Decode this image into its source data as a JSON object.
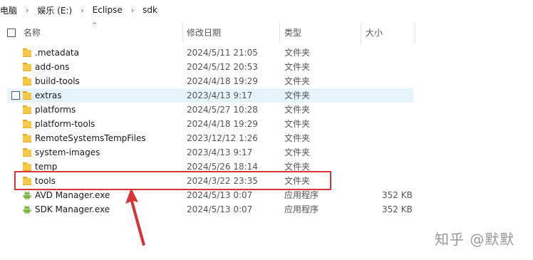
{
  "breadcrumb": {
    "items": [
      "电脑",
      "娱乐 (E:)",
      "Eclipse",
      "sdk"
    ],
    "separator": "›"
  },
  "header": {
    "name": "名称",
    "date": "修改日期",
    "type": "类型",
    "size": "大小"
  },
  "files": [
    {
      "name": ".metadata",
      "date": "2024/5/11 21:05",
      "type": "文件夹",
      "size": "",
      "icon": "folder-icon"
    },
    {
      "name": "add-ons",
      "date": "2024/5/12 20:53",
      "type": "文件夹",
      "size": "",
      "icon": "folder-icon"
    },
    {
      "name": "build-tools",
      "date": "2024/4/18 19:29",
      "type": "文件夹",
      "size": "",
      "icon": "folder-icon"
    },
    {
      "name": "extras",
      "date": "2023/4/13 9:17",
      "type": "文件夹",
      "size": "",
      "icon": "folder-icon",
      "hovered": true
    },
    {
      "name": "platforms",
      "date": "2024/5/27 10:28",
      "type": "文件夹",
      "size": "",
      "icon": "folder-icon"
    },
    {
      "name": "platform-tools",
      "date": "2024/4/18 19:29",
      "type": "文件夹",
      "size": "",
      "icon": "folder-icon"
    },
    {
      "name": "RemoteSystemsTempFiles",
      "date": "2023/12/12 1:26",
      "type": "文件夹",
      "size": "",
      "icon": "folder-icon"
    },
    {
      "name": "system-images",
      "date": "2023/4/13 9:17",
      "type": "文件夹",
      "size": "",
      "icon": "folder-icon"
    },
    {
      "name": "temp",
      "date": "2024/5/26 18:14",
      "type": "文件夹",
      "size": "",
      "icon": "folder-icon"
    },
    {
      "name": "tools",
      "date": "2024/3/22 23:35",
      "type": "文件夹",
      "size": "",
      "icon": "folder-icon",
      "highlighted": true
    },
    {
      "name": "AVD Manager.exe",
      "date": "2024/5/13 0:07",
      "type": "应用程序",
      "size": "352 KB",
      "icon": "android-icon"
    },
    {
      "name": "SDK Manager.exe",
      "date": "2024/5/13 0:07",
      "type": "应用程序",
      "size": "352 KB",
      "icon": "android-icon"
    }
  ],
  "watermark": "知乎 @默默",
  "colors": {
    "hover_row": "#e5f3fb",
    "annotation_red": "#d9343a",
    "folder_yellow": "#f6c84a",
    "android_green": "#7cb342"
  }
}
